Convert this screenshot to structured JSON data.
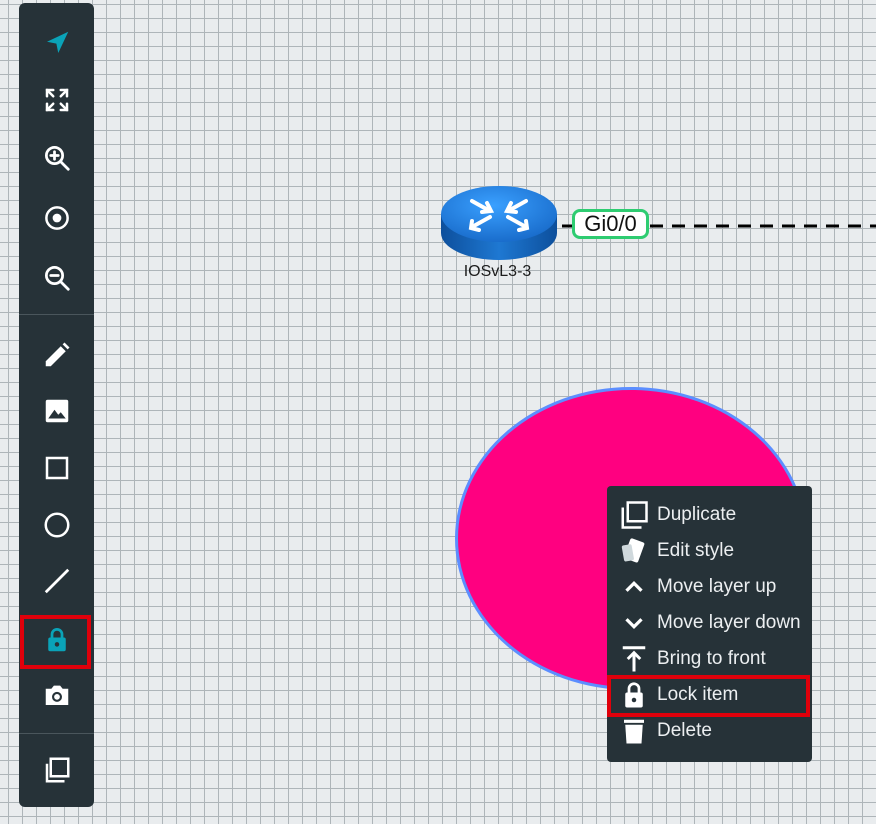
{
  "colors": {
    "toolbar_bg": "#263238",
    "active_tool": "#0aa3b8",
    "highlight": "#e0000b",
    "shape_fill": "#ff0080",
    "shape_stroke": "#5c8eff",
    "interface_border": "#2ecc71",
    "router": "#1e78d2"
  },
  "toolbar": {
    "tools": [
      {
        "icon": "select-arrow-icon",
        "active": true
      },
      {
        "icon": "fit-screen-icon"
      },
      {
        "icon": "zoom-in-icon"
      },
      {
        "icon": "center-icon"
      },
      {
        "icon": "zoom-out-icon"
      },
      {
        "icon": "pencil-icon"
      },
      {
        "icon": "image-icon"
      },
      {
        "icon": "rectangle-icon"
      },
      {
        "icon": "circle-icon"
      },
      {
        "icon": "line-icon"
      },
      {
        "icon": "lock-icon",
        "highlighted": true
      },
      {
        "icon": "camera-icon"
      },
      {
        "icon": "copy-icon"
      }
    ]
  },
  "canvas": {
    "node": {
      "label": "IOSvL3-3",
      "icon": "router-icon"
    },
    "interface_label": "Gi0/0"
  },
  "context_menu": {
    "items": [
      {
        "label": "Duplicate",
        "icon": "duplicate-icon"
      },
      {
        "label": "Edit style",
        "icon": "edit-style-icon"
      },
      {
        "label": "Move layer up",
        "icon": "chevron-up-icon"
      },
      {
        "label": "Move layer down",
        "icon": "chevron-down-icon"
      },
      {
        "label": "Bring to front",
        "icon": "bring-to-front-icon"
      },
      {
        "label": "Lock item",
        "icon": "lock-icon",
        "highlighted": true
      },
      {
        "label": "Delete",
        "icon": "trash-icon"
      }
    ]
  }
}
